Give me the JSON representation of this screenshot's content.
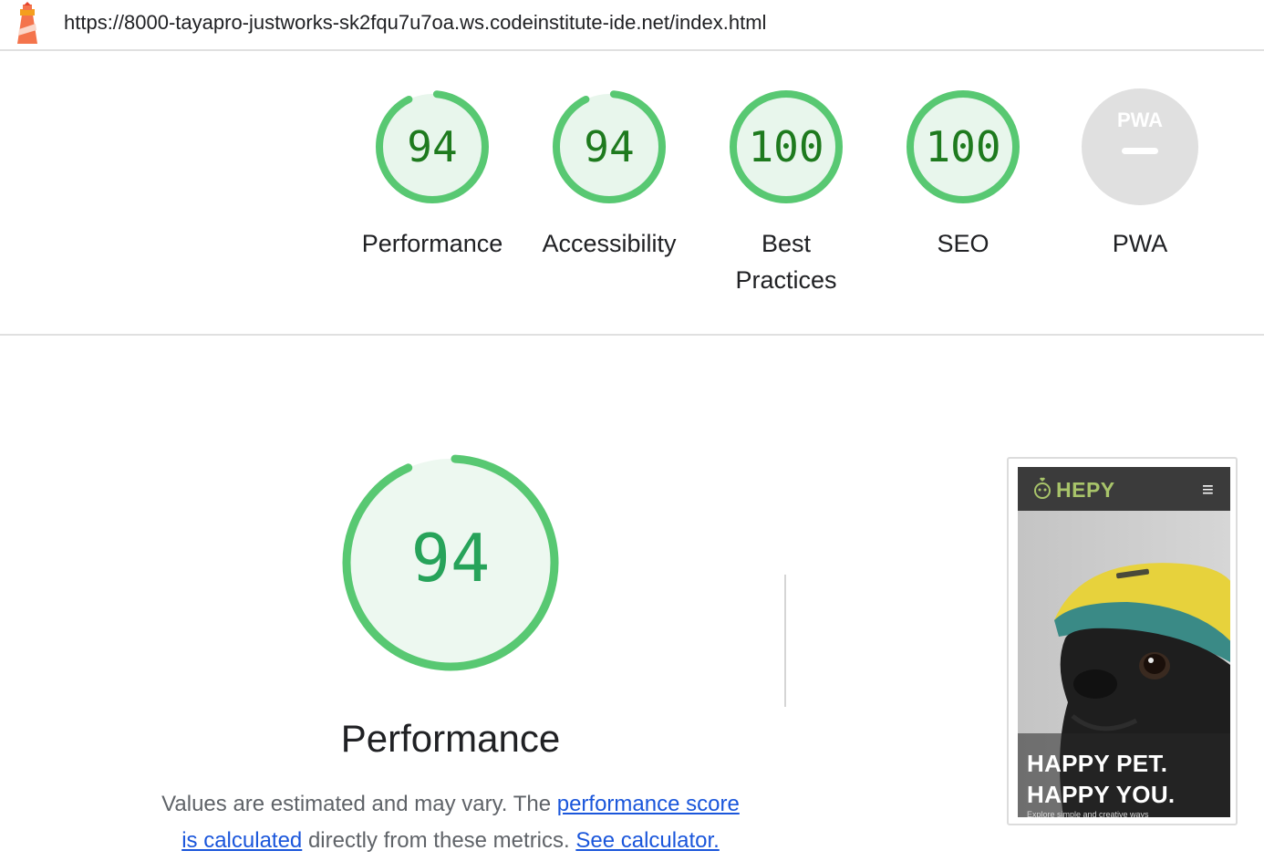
{
  "header": {
    "url": "https://8000-tayapro-justworks-sk2fqu7u7oa.ws.codeinstitute-ide.net/index.html"
  },
  "gauges": [
    {
      "label": "Performance",
      "score": "94"
    },
    {
      "label": "Accessibility",
      "score": "94"
    },
    {
      "label_line1": "Best",
      "label_line2": "Practices",
      "score": "100"
    },
    {
      "label": "SEO",
      "score": "100"
    },
    {
      "label": "PWA",
      "badge": "PWA"
    }
  ],
  "gauge_values": [
    0.94,
    0.94,
    1.0,
    1.0
  ],
  "main": {
    "score": "94",
    "score_value": 0.94,
    "title": "Performance",
    "desc_part1": "Values are estimated and may vary. The ",
    "link1_line1": "performance score",
    "link1_line2": "is calculated",
    "desc_part2": " directly from these metrics. ",
    "link2": "See calculator."
  },
  "thumbnail": {
    "brand": "HEPY",
    "menu_icon": "≡",
    "hero_line1": "HAPPY PET.",
    "hero_line2": "HAPPY YOU.",
    "hero_sub": "Explore simple and creative ways"
  },
  "colors": {
    "pass_green": "#0cce6b",
    "pass_text": "#1e7a1e",
    "pass_bg": "#e8f6ec",
    "pwa_gray": "#e0e0e0",
    "link_blue": "#1a56db"
  }
}
